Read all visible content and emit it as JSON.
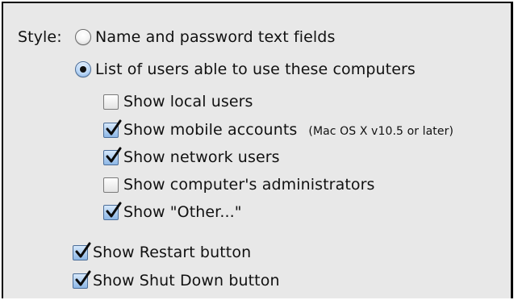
{
  "style_label": "Style:",
  "style_options": [
    {
      "label": "Name and password text fields",
      "selected": false
    },
    {
      "label": "List of users able to use these computers",
      "selected": true
    }
  ],
  "user_checkboxes": [
    {
      "label": "Show local users",
      "checked": false
    },
    {
      "label": "Show mobile accounts",
      "note": "(Mac OS X v10.5 or later)",
      "checked": true
    },
    {
      "label": "Show network users",
      "checked": true
    },
    {
      "label": "Show computer's administrators",
      "checked": false
    },
    {
      "label": "Show \"Other...\"",
      "checked": true
    }
  ],
  "button_checkboxes": [
    {
      "label": "Show Restart button",
      "checked": true
    },
    {
      "label": "Show Shut Down button",
      "checked": true
    }
  ]
}
